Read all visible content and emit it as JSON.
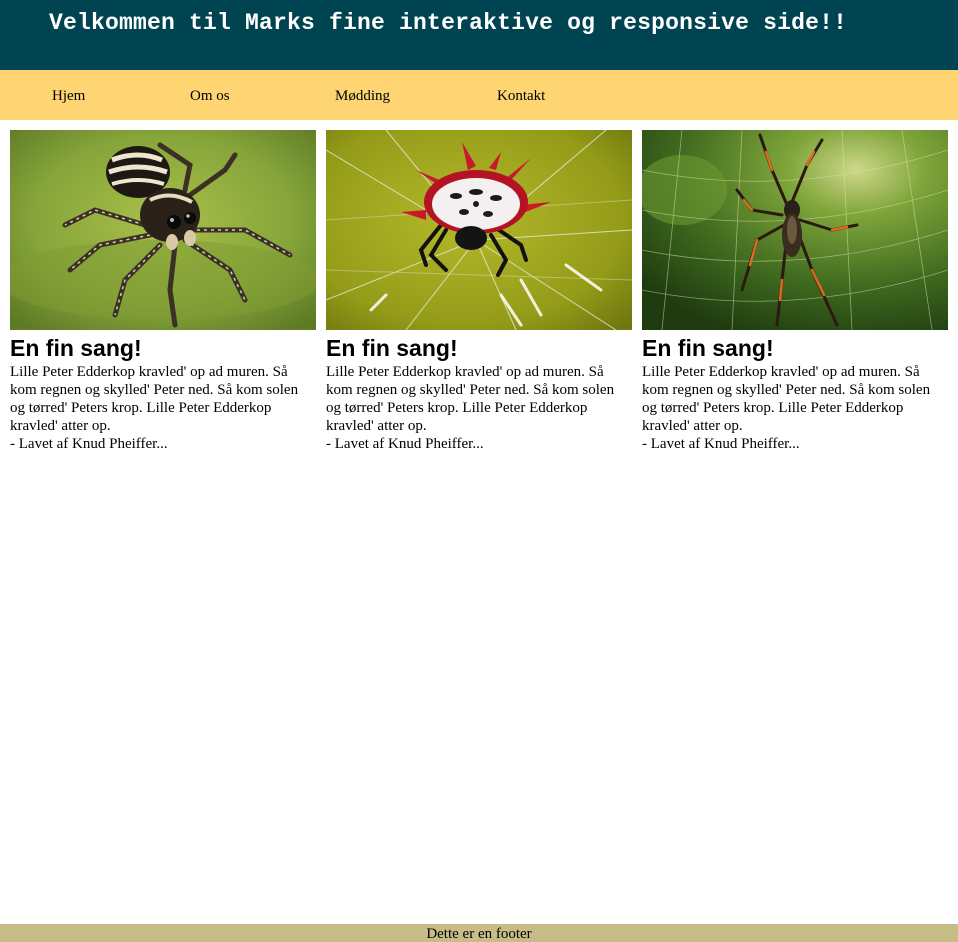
{
  "header": {
    "title": "Velkommen til Marks fine interaktive og responsive side!!"
  },
  "nav": {
    "items": [
      {
        "label": "Hjem"
      },
      {
        "label": "Om os"
      },
      {
        "label": "Mødding"
      },
      {
        "label": "Kontakt"
      }
    ]
  },
  "cards": [
    {
      "image": "jumping-spider-photo",
      "title": "En fin sang!",
      "text": "Lille Peter Edderkop kravled' op ad muren. Så kom regnen og skylled' Peter ned. Så kom solen og tørred' Peters krop. Lille Peter Edderkop kravled' atter op.",
      "credit": "- Lavet af Knud Pheiffer..."
    },
    {
      "image": "spiny-orb-weaver-photo",
      "title": "En fin sang!",
      "text": "Lille Peter Edderkop kravled' op ad muren. Så kom regnen og skylled' Peter ned. Så kom solen og tørred' Peters krop. Lille Peter Edderkop kravled' atter op.",
      "credit": "- Lavet af Knud Pheiffer..."
    },
    {
      "image": "golden-orb-weaver-photo",
      "title": "En fin sang!",
      "text": "Lille Peter Edderkop kravled' op ad muren. Så kom regnen og skylled' Peter ned. Så kom solen og tørred' Peters krop. Lille Peter Edderkop kravled' atter op.",
      "credit": "- Lavet af Knud Pheiffer..."
    }
  ],
  "footer": {
    "text": "Dette er en footer"
  },
  "colors": {
    "header_bg": "#014451",
    "nav_bg": "#fed572",
    "footer_bg": "#c8bd87"
  }
}
